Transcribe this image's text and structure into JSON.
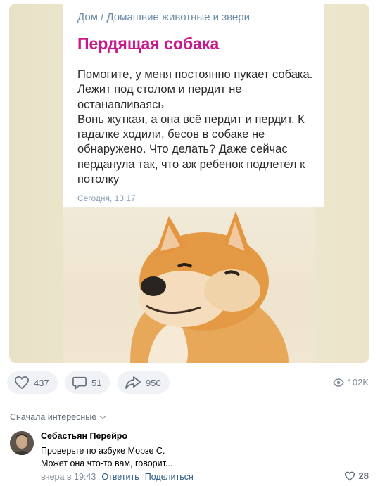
{
  "post": {
    "breadcrumb": "Дом / Домашние животные и звери",
    "title": "Пердящая собака",
    "body_lines": [
      "Помогите, у меня постоянно пукает собака.",
      "Лежит под столом и пердит не",
      "останавливаясь",
      "Вонь жуткая, а она всё пердит и пердит. К",
      "гадалке ходили, бесов в собаке не",
      "обнаружено. Что делать? Даже сейчас",
      "перданула так, что аж ребенок подлетел к",
      "потолку"
    ],
    "time": "Сегодня, 13:17"
  },
  "actions": {
    "likes": "437",
    "comments": "51",
    "shares": "950",
    "views": "102K"
  },
  "comments_section": {
    "sort_label": "Сначала интересные",
    "comment": {
      "author": "Себастьян Перейро",
      "text_lines": [
        "Проверьте по азбуке Морзе С.",
        "Может она что-то вам, говорит..."
      ],
      "time": "вчера в 19:43",
      "reply_label": "Ответить",
      "share_label": "Поделиться",
      "likes": "28"
    }
  },
  "colors": {
    "title": "#c8188c",
    "breadcrumb": "#6a8aa6",
    "link": "#2a5885",
    "button_bg": "#f0f2f5",
    "icon": "#626d7a"
  },
  "icons": [
    "heart-icon",
    "comment-icon",
    "share-icon",
    "eye-icon",
    "chevron-down-icon"
  ]
}
